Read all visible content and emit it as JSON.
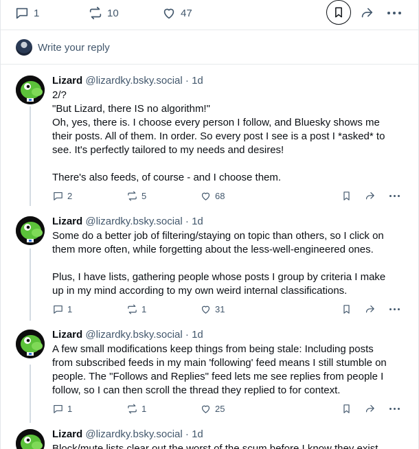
{
  "top_actions": {
    "replies": "1",
    "reposts": "10",
    "likes": "47"
  },
  "reply_prompt": "Write your reply",
  "posts": [
    {
      "author": "Lizard",
      "handle": "@lizardky.bsky.social",
      "separator": "·",
      "time": "1d",
      "lines": [
        "2/?",
        "\"But Lizard, there IS no algorithm!\"",
        "Oh, yes, there is. I choose every person I follow, and Bluesky shows me",
        "their posts. All of them. In order. So every post I see is a post I *asked* to",
        "see. It's perfectly tailored to my needs and desires!",
        "",
        "There's also feeds, of course - and I choose them."
      ],
      "replies": "2",
      "reposts": "5",
      "likes": "68"
    },
    {
      "author": "Lizard",
      "handle": "@lizardky.bsky.social",
      "separator": "·",
      "time": "1d",
      "lines": [
        "Some do a better job of filtering/staying on topic than others, so I click on",
        "them more often, while forgetting about the less-well-engineered ones.",
        "",
        "Plus, I have lists, gathering people whose posts I group by criteria I make",
        "up in my mind according to my own weird internal classifications."
      ],
      "replies": "1",
      "reposts": "1",
      "likes": "31"
    },
    {
      "author": "Lizard",
      "handle": "@lizardky.bsky.social",
      "separator": "·",
      "time": "1d",
      "lines": [
        "A few small modifications keep things from being stale: Including posts",
        "from subscribed feeds in my main 'following' feed means I still stumble on",
        "people. The \"Follows and Replies\" feed lets me see replies from people I",
        "follow, so I can then scroll the thread they replied to for context."
      ],
      "replies": "1",
      "reposts": "1",
      "likes": "25"
    },
    {
      "author": "Lizard",
      "handle": "@lizardky.bsky.social",
      "separator": "·",
      "time": "1d",
      "lines": [
        "Block/mute lists clear out the worst of the scum before I know they exist."
      ]
    }
  ]
}
